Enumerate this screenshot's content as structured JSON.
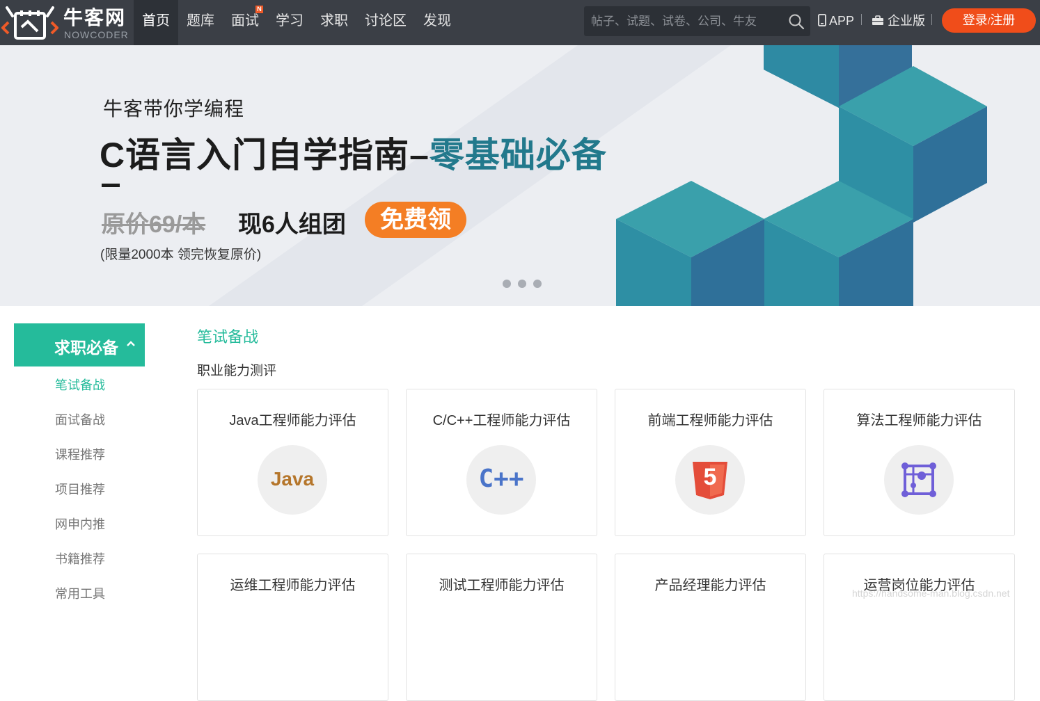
{
  "header": {
    "logo": {
      "name": "牛客网",
      "subtitle": "NOWCODER"
    },
    "nav": [
      {
        "label": "首页",
        "active": true
      },
      {
        "label": "题库"
      },
      {
        "label": "面试",
        "badge": "N"
      },
      {
        "label": "学习"
      },
      {
        "label": "求职"
      },
      {
        "label": "讨论区"
      },
      {
        "label": "发现"
      }
    ],
    "search": {
      "placeholder": "帖子、试题、试卷、公司、牛友",
      "icon": "search-icon"
    },
    "links": {
      "app": "APP",
      "enterprise": "企业版"
    },
    "login": {
      "login_label": "登录",
      "separator": "/",
      "register_label": "注册"
    }
  },
  "banner": {
    "subtitle": "牛客带你学编程",
    "title_main": "C语言入门自学指南–",
    "title_highlight": "零基础必备",
    "old_price": "原价69/本",
    "promo": "现6人组团",
    "cta": "免费领",
    "note": "(限量2000本 领完恢复原价)",
    "dot_count": 3
  },
  "sidebar": {
    "header": "求职必备",
    "items": [
      {
        "label": "笔试备战",
        "active": true
      },
      {
        "label": "面试备战"
      },
      {
        "label": "课程推荐"
      },
      {
        "label": "项目推荐"
      },
      {
        "label": "网申内推"
      },
      {
        "label": "书籍推荐"
      },
      {
        "label": "常用工具"
      }
    ]
  },
  "main": {
    "section_title": "笔试备战",
    "section_subtitle": "职业能力测评",
    "cards": [
      {
        "title": "Java工程师能力评估",
        "icon": "java-icon",
        "icon_text": "Java"
      },
      {
        "title": "C/C++工程师能力评估",
        "icon": "cpp-icon",
        "icon_text": "C++"
      },
      {
        "title": "前端工程师能力评估",
        "icon": "html5-icon",
        "icon_text": "5"
      },
      {
        "title": "算法工程师能力评估",
        "icon": "algorithm-icon"
      },
      {
        "title": "运维工程师能力评估"
      },
      {
        "title": "测试工程师能力评估"
      },
      {
        "title": "产品经理能力评估"
      },
      {
        "title": "运营岗位能力评估"
      }
    ]
  },
  "watermark": "https://handsome-man.blog.csdn.net",
  "colors": {
    "header_bg": "#3b3f46",
    "accent": "#25bb9b",
    "login": "#f04d1a",
    "banner_highlight": "#22798c",
    "cta": "#f47e24"
  }
}
